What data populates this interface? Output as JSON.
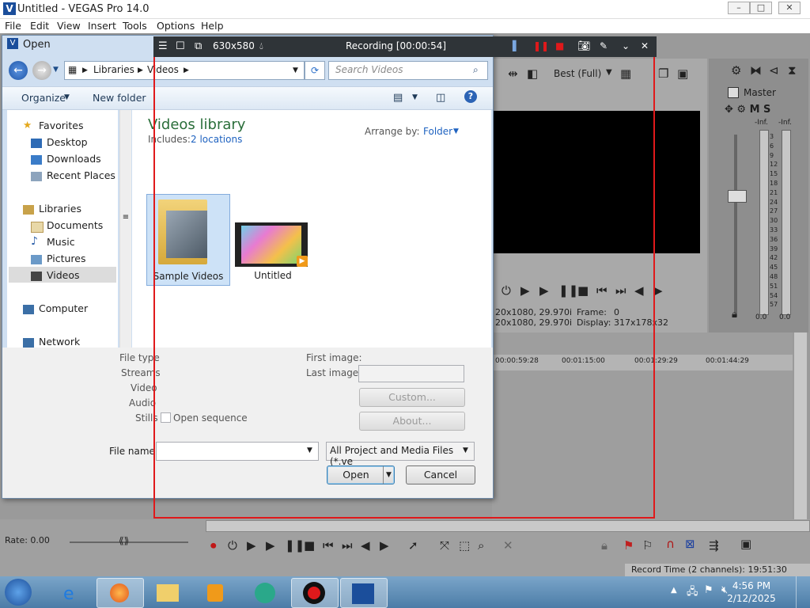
{
  "vegas": {
    "title": "Untitled - VEGAS Pro 14.0",
    "window_controls": [
      "–",
      "□",
      "✕"
    ],
    "menu": [
      "File",
      "Edit",
      "View",
      "Insert",
      "Tools",
      "Options",
      "Help"
    ],
    "preview_quality": "Best (Full)",
    "master_label": "Master",
    "meter_inf": "-Inf.",
    "meter_ticks": [
      "3",
      "6",
      "9",
      "12",
      "15",
      "18",
      "21",
      "24",
      "27",
      "30",
      "33",
      "36",
      "39",
      "42",
      "45",
      "48",
      "51",
      "54",
      "57"
    ],
    "meter_bottom": "0.0",
    "info_line1": "20x1080, 29.970i",
    "info_line2": "20x1080, 29.970i",
    "frame_label": "Frame:",
    "frame_value": "0",
    "display_label": "Display:",
    "display_value": "317x178x32",
    "ruler_times": [
      "00:00:59:28",
      "00:01:15:00",
      "00:01:29:29",
      "00:01:44:29"
    ],
    "rate_label": "Rate: 0.00",
    "record_time": "Record Time (2 channels): 19:51:30"
  },
  "dialog": {
    "title": "Open",
    "breadcrumb": [
      "Libraries",
      "Videos"
    ],
    "search_placeholder": "Search Videos",
    "organize_label": "Organize",
    "new_folder_label": "New folder",
    "nav": {
      "favorites": "Favorites",
      "desktop": "Desktop",
      "downloads": "Downloads",
      "recent": "Recent Places",
      "libraries": "Libraries",
      "documents": "Documents",
      "music": "Music",
      "pictures": "Pictures",
      "videos": "Videos",
      "computer": "Computer",
      "network": "Network"
    },
    "library_title": "Videos library",
    "includes_label": "Includes:",
    "includes_link": "2 locations",
    "arrange_label": "Arrange by:",
    "arrange_value": "Folder",
    "items": [
      {
        "name": "Sample Videos"
      },
      {
        "name": "Untitled"
      }
    ],
    "props": {
      "file_type": "File type",
      "streams": "Streams",
      "video": "Video",
      "audio": "Audio",
      "stills": "Stills",
      "open_sequence": "Open sequence",
      "first_image": "First image:",
      "last_image": "Last image:",
      "custom_button": "Custom...",
      "about_button": "About..."
    },
    "file_name_label": "File name:",
    "file_name_value": "",
    "file_type_filter": "All Project and Media Files (*.ve",
    "open_button": "Open",
    "cancel_button": "Cancel"
  },
  "recorder": {
    "size": "630x580",
    "status": "Recording [00:00:54]"
  },
  "taskbar": {
    "time": "4:56 PM",
    "date": "2/12/2025"
  }
}
